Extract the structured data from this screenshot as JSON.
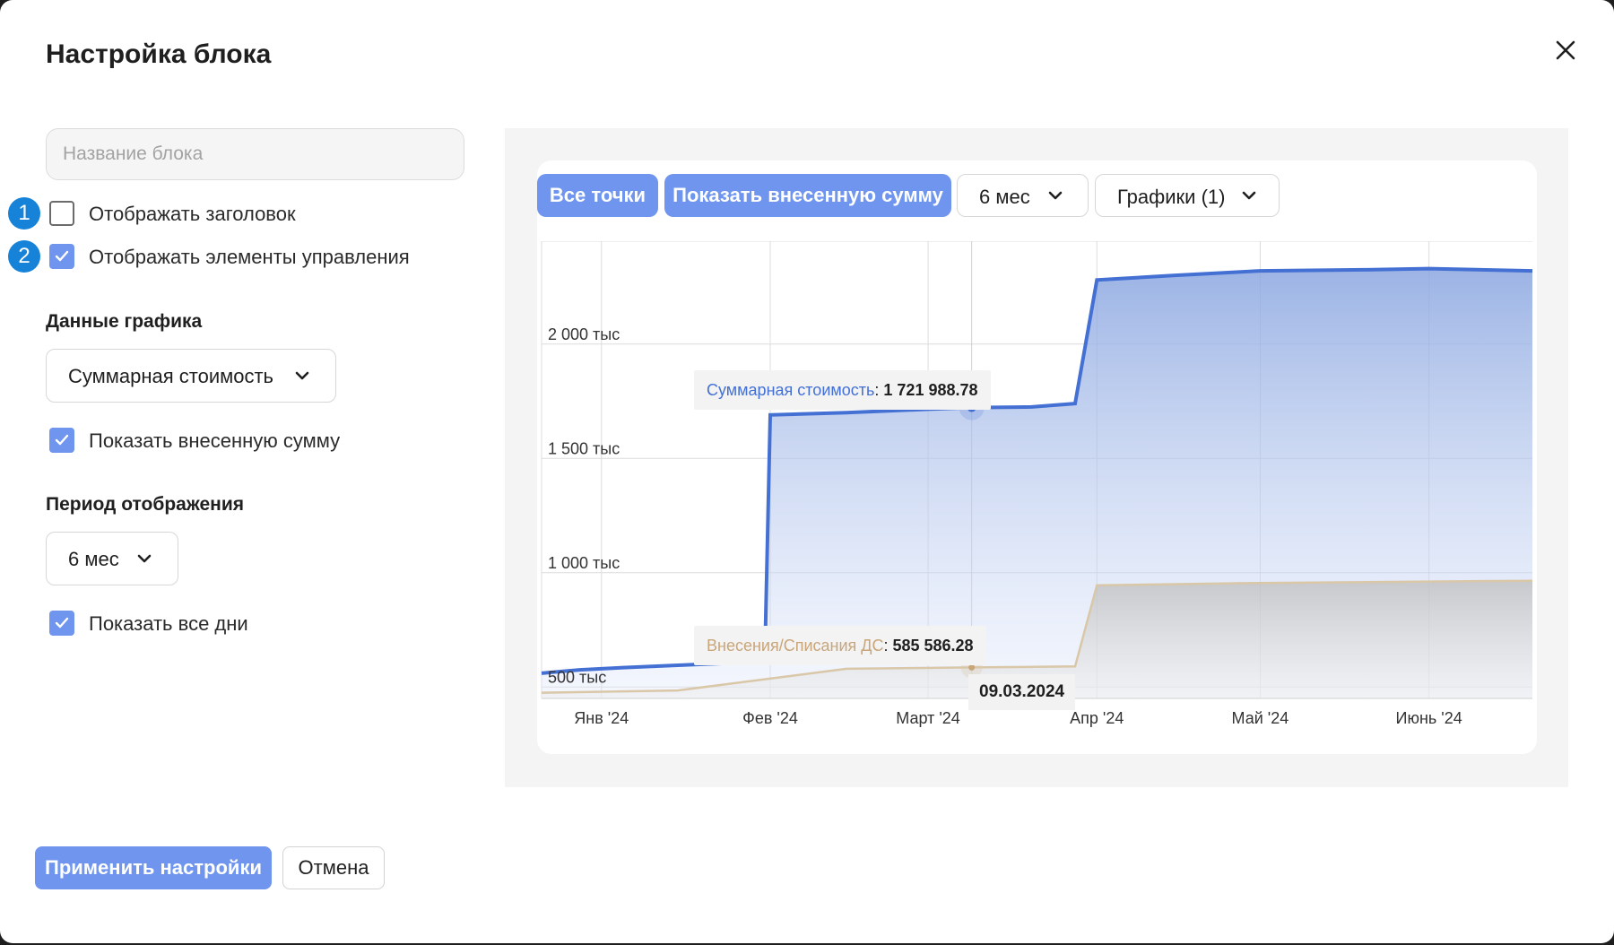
{
  "dialog": {
    "title": "Настройка блока",
    "name_input": {
      "placeholder": "Название блока",
      "value": ""
    },
    "options": [
      {
        "badge": "1",
        "label": "Отображать заголовок",
        "checked": false
      },
      {
        "badge": "2",
        "label": "Отображать элементы управления",
        "checked": true
      }
    ],
    "chart_data_section": {
      "label": "Данные графика",
      "select_value": "Суммарная стоимость",
      "show_contributed": {
        "label": "Показать внесенную сумму",
        "checked": true
      }
    },
    "period_section": {
      "label": "Период отображения",
      "select_value": "6 мес",
      "show_all_days": {
        "label": "Показать все дни",
        "checked": true
      }
    },
    "apply_label": "Применить настройки",
    "cancel_label": "Отмена"
  },
  "preview": {
    "buttons": {
      "all_points": "Все точки",
      "show_contributed": "Показать внесенную сумму",
      "period": "6 мес",
      "charts": "Графики (1)"
    },
    "tooltip": {
      "series1_name": "Суммарная стоимость",
      "series1_value": "1 721 988.78",
      "series2_name": "Внесения/Списания ДС",
      "series2_value": "585 586.28",
      "date": "09.03.2024"
    },
    "colors": {
      "series1": "#4470d4",
      "series2": "#d9c7a8",
      "accent": "#6f95ee"
    }
  },
  "chart_data": {
    "type": "area",
    "title": "",
    "xlabel": "",
    "ylabel": "",
    "x_ticks": [
      "Янв '24",
      "Фев '24",
      "Март '24",
      "Апр '24",
      "Май '24",
      "Июнь '24"
    ],
    "y_ticks": [
      "500 тыс",
      "1 000 тыс",
      "1 500 тыс",
      "2 000 тыс"
    ],
    "ylim": [
      450000,
      2450000
    ],
    "xlim": [
      "2023-12-21",
      "2024-06-20"
    ],
    "grid": true,
    "series": [
      {
        "name": "Суммарная стоимость",
        "color": "#4470d4",
        "points": [
          [
            "2023-12-21",
            560000
          ],
          [
            "2023-12-28",
            575000
          ],
          [
            "2024-01-05",
            585000
          ],
          [
            "2024-01-15",
            595000
          ],
          [
            "2024-01-25",
            605000
          ],
          [
            "2024-01-31",
            610000
          ],
          [
            "2024-02-01",
            1690000
          ],
          [
            "2024-02-15",
            1700000
          ],
          [
            "2024-03-01",
            1715000
          ],
          [
            "2024-03-09",
            1721988.78
          ],
          [
            "2024-03-20",
            1725000
          ],
          [
            "2024-03-28",
            1740000
          ],
          [
            "2024-04-01",
            2280000
          ],
          [
            "2024-04-15",
            2300000
          ],
          [
            "2024-05-01",
            2320000
          ],
          [
            "2024-05-20",
            2325000
          ],
          [
            "2024-06-01",
            2330000
          ],
          [
            "2024-06-20",
            2320000
          ]
        ]
      },
      {
        "name": "Внесения/Списания ДС",
        "color": "#d9c7a8",
        "points": [
          [
            "2023-12-21",
            475000
          ],
          [
            "2024-01-15",
            485000
          ],
          [
            "2024-02-15",
            580000
          ],
          [
            "2024-03-09",
            585586.28
          ],
          [
            "2024-03-28",
            590000
          ],
          [
            "2024-04-01",
            945000
          ],
          [
            "2024-05-01",
            955000
          ],
          [
            "2024-06-20",
            965000
          ]
        ]
      }
    ]
  }
}
